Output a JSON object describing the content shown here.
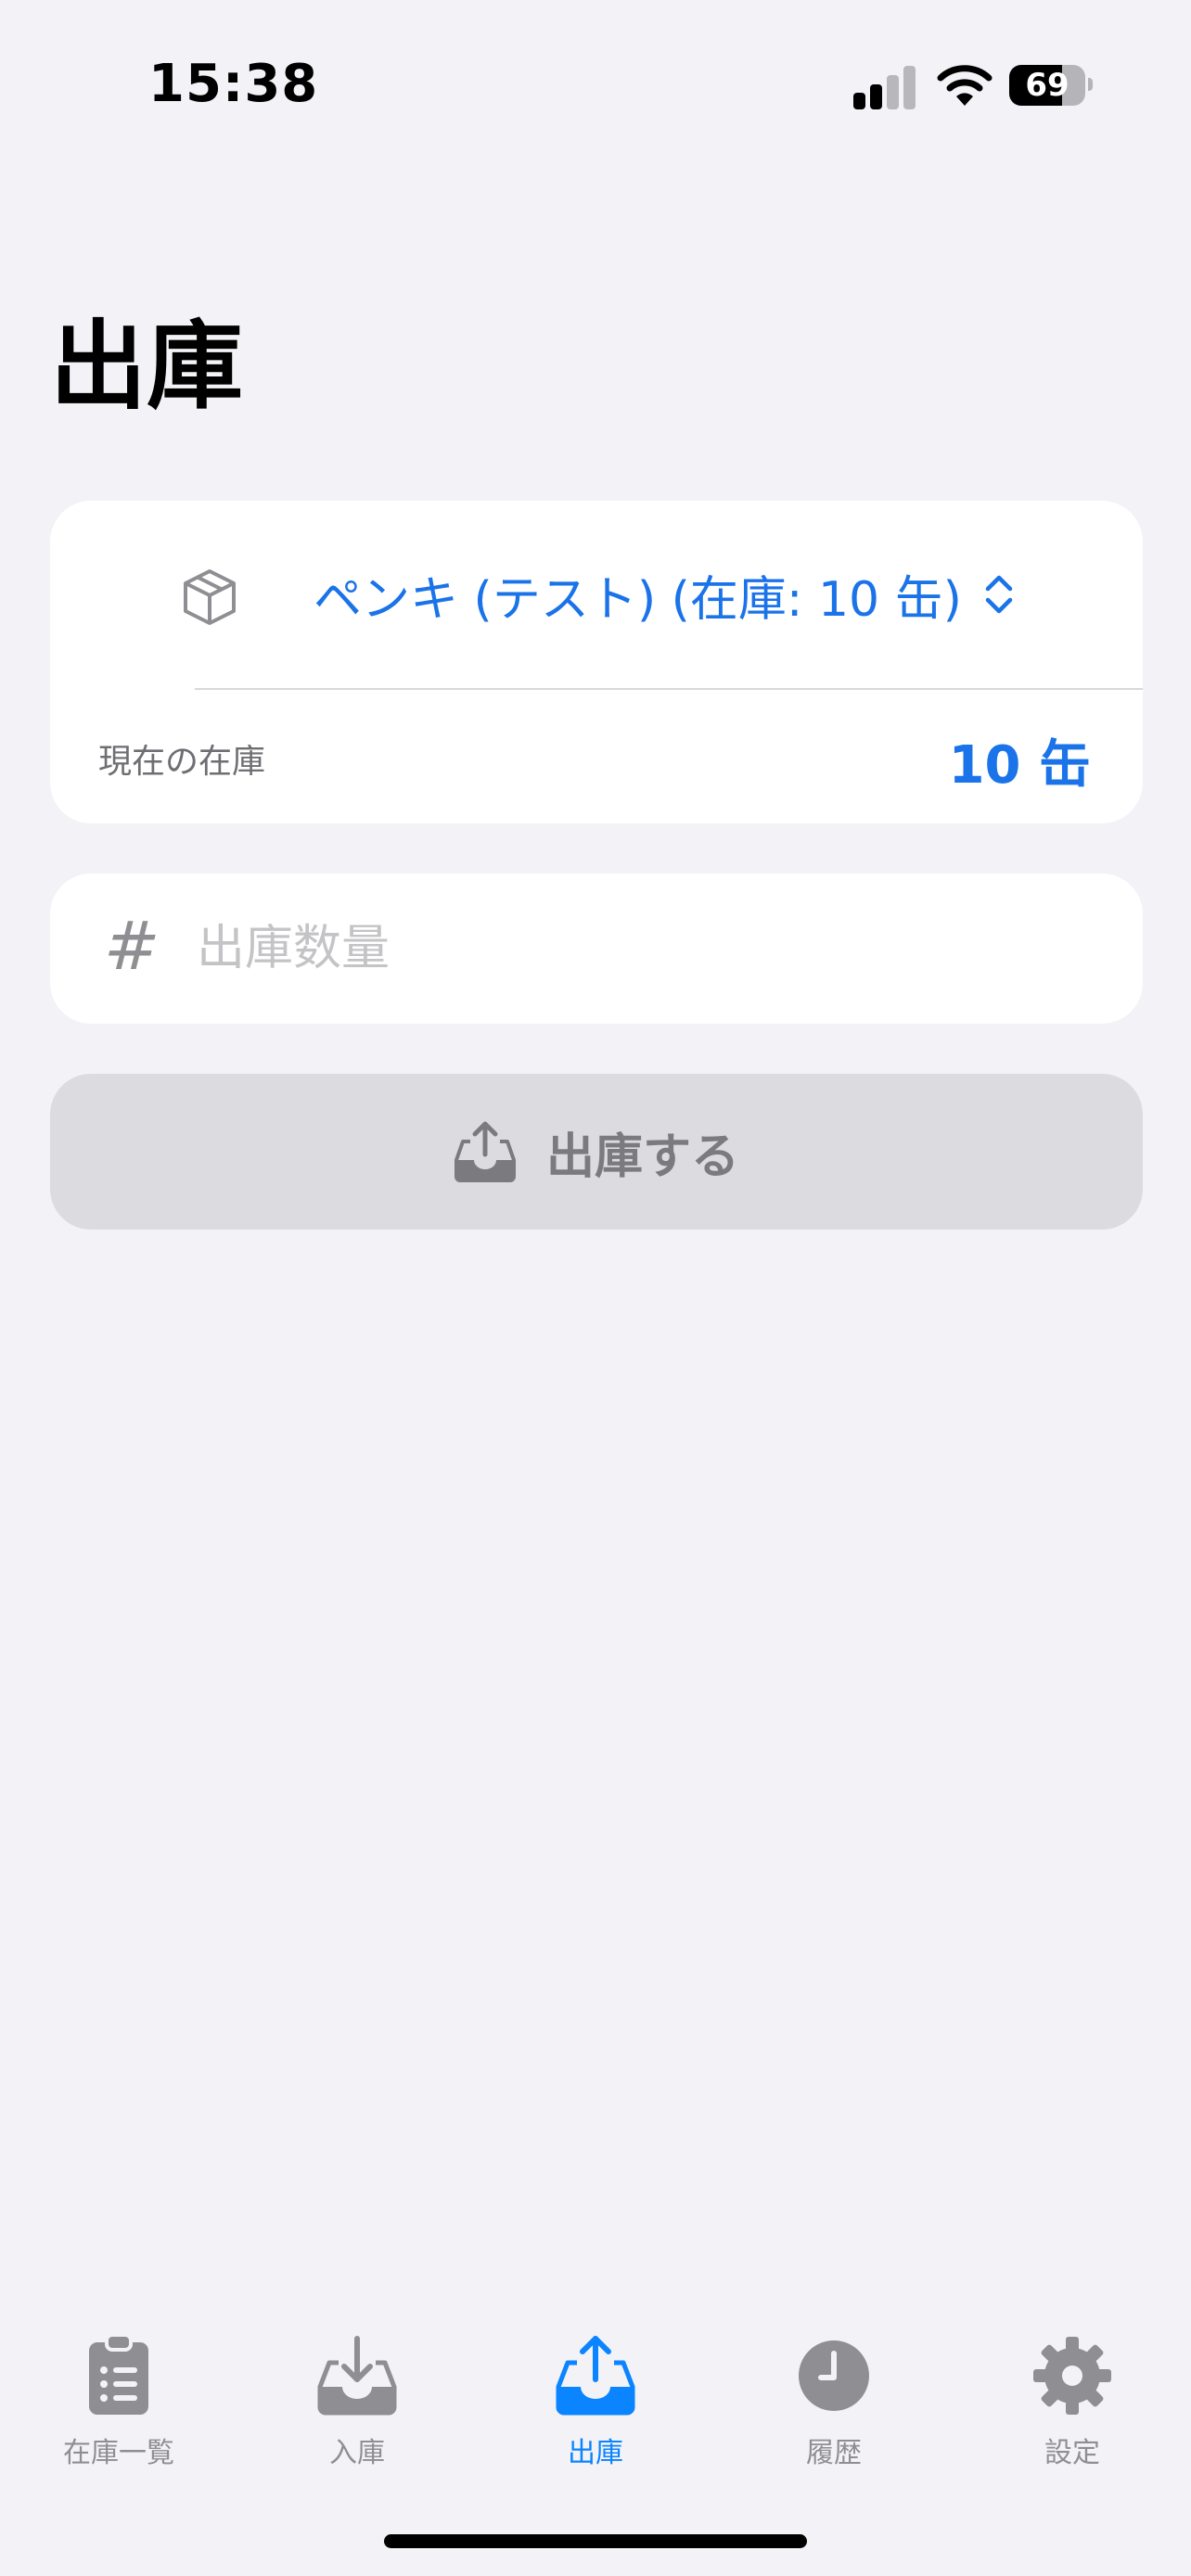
{
  "status_bar": {
    "time": "15:38",
    "battery_level": 69,
    "battery_text": "69",
    "signal_bars_active": 2,
    "signal_bars_total": 4
  },
  "page": {
    "title": "出庫"
  },
  "product_card": {
    "icon": "cube-icon",
    "selected_product": "ペンキ (テスト) (在庫: 10 缶)",
    "current_stock_label": "現在の在庫",
    "current_stock_value": "10 缶"
  },
  "quantity_field": {
    "icon": "number-sign-icon",
    "placeholder": "出庫数量",
    "value": ""
  },
  "submit_button": {
    "icon": "tray-upload-icon",
    "label": "出庫する",
    "enabled": false
  },
  "tab_bar": {
    "items": [
      {
        "label": "在庫一覧",
        "icon": "clipboard-list-icon",
        "active": false
      },
      {
        "label": "入庫",
        "icon": "tray-download-icon",
        "active": false
      },
      {
        "label": "出庫",
        "icon": "tray-upload-icon",
        "active": true
      },
      {
        "label": "履歴",
        "icon": "clock-icon",
        "active": false
      },
      {
        "label": "設定",
        "icon": "gear-icon",
        "active": false
      }
    ]
  },
  "colors": {
    "accent": "#1a73e8",
    "tab_active": "#0a84ff",
    "tab_inactive": "#8e8e93",
    "background": "#f2f2f7",
    "disabled_button": "#dcdce0"
  }
}
